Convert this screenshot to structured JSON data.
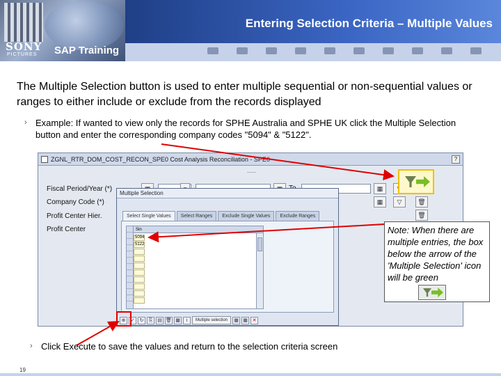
{
  "header": {
    "title": "Entering Selection Criteria – Multiple Values",
    "logo_text": "SONY",
    "logo_subtext": "PICTURES",
    "brand": "SAP Training"
  },
  "intro": "The Multiple Selection button is used to enter multiple sequential or non-sequential values or ranges to either include or exclude from the records displayed",
  "bullets": [
    "Example:  If wanted to view only the records for SPHE Australia and SPHE UK click the Multiple Selection button and enter the corresponding company codes \"5094\" & \"5122\".",
    "Click Execute to save the values and return to the selection criteria screen"
  ],
  "sap_screen": {
    "title": "ZGNL_RTR_DOM_COST_RECON_SPE0 Cost Analysis Reconciliation - SPE0",
    "fields": [
      "Fiscal Period/Year (*)",
      "Company Code (*)",
      "Profit Center Hier.",
      "Profit Center"
    ],
    "to_label": "To",
    "dialog": {
      "title": "Multiple Selection",
      "tabs": [
        "Select Single Values",
        "Select Ranges",
        "Exclude Single Values",
        "Exclude Ranges"
      ],
      "column_header": "Sin",
      "values": [
        "5094",
        "5122"
      ],
      "toolbar_button": "Multiple selection"
    }
  },
  "note": {
    "text": "Note: When there are multiple entries, the box below the arrow of the 'Multiple Selection' icon will be green"
  },
  "page_number": "19",
  "icons": [
    "multiple-selection-icon",
    "execute-icon",
    "delete-icon",
    "arrow-green-icon"
  ]
}
